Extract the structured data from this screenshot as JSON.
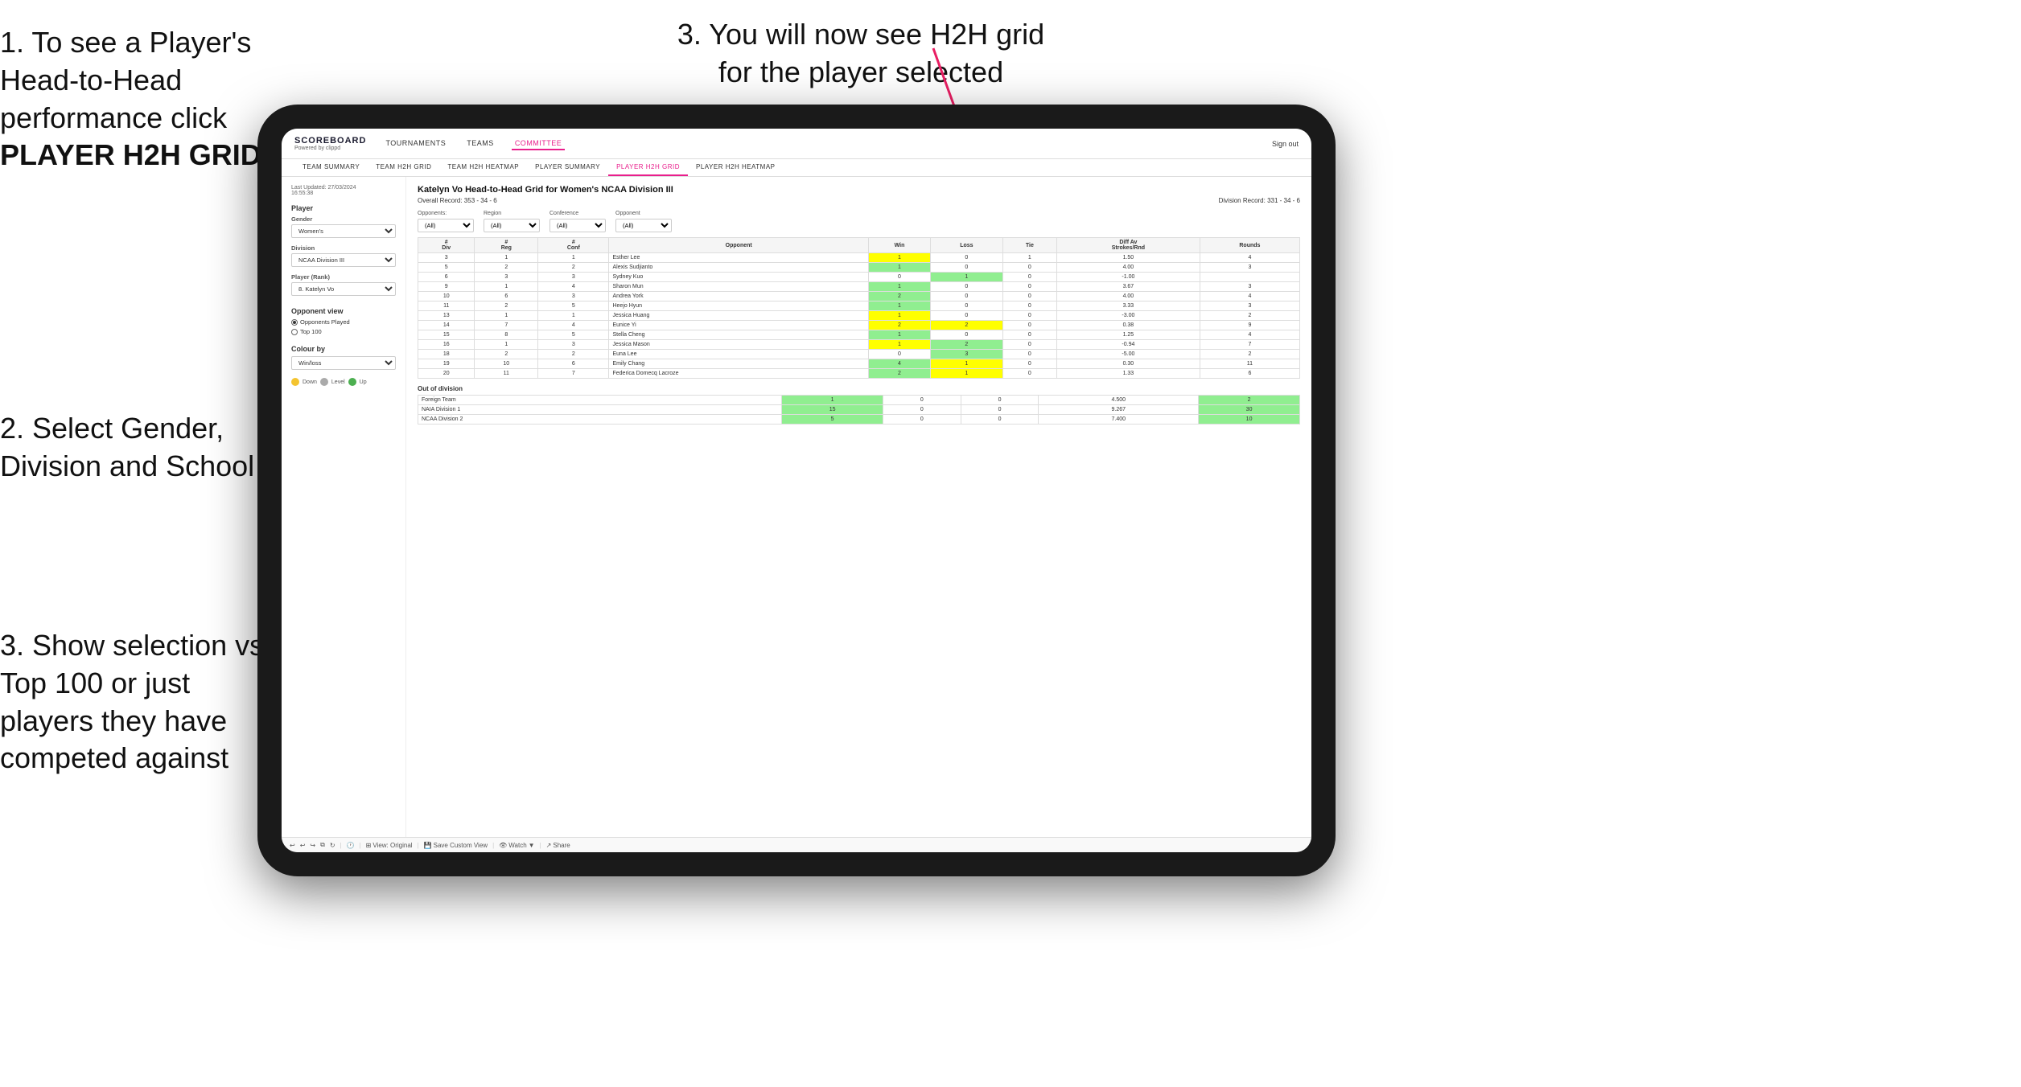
{
  "instructions": {
    "step1_heading": "1. To see a Player's Head-to-Head performance click",
    "step1_bold": "PLAYER H2H GRID",
    "step3_top": "3. You will now see H2H grid for the player selected",
    "step2": "2. Select Gender, Division and School",
    "step3_bottom": "3. Show selection vs Top 100 or just players they have competed against"
  },
  "nav": {
    "logo": "SCOREBOARD",
    "logo_sub": "Powered by clippd",
    "items": [
      "TOURNAMENTS",
      "TEAMS",
      "COMMITTEE"
    ],
    "active_item": "COMMITTEE",
    "sign_out": "Sign out"
  },
  "sub_nav": {
    "items": [
      "TEAM SUMMARY",
      "TEAM H2H GRID",
      "TEAM H2H HEATMAP",
      "PLAYER SUMMARY",
      "PLAYER H2H GRID",
      "PLAYER H2H HEATMAP"
    ],
    "active": "PLAYER H2H GRID"
  },
  "left_panel": {
    "last_updated": "Last Updated: 27/03/2024",
    "last_updated_time": "16:55:38",
    "player_section": "Player",
    "gender_label": "Gender",
    "gender_value": "Women's",
    "division_label": "Division",
    "division_value": "NCAA Division III",
    "player_rank_label": "Player (Rank)",
    "player_rank_value": "8. Katelyn Vo",
    "opponent_view_label": "Opponent view",
    "opponent_options": [
      "Opponents Played",
      "Top 100"
    ],
    "selected_opponent": "Opponents Played",
    "colour_by_label": "Colour by",
    "colour_by_value": "Win/loss",
    "legend": [
      {
        "color": "#f4c430",
        "label": "Down"
      },
      {
        "color": "#aaa",
        "label": "Level"
      },
      {
        "color": "#4caf50",
        "label": "Up"
      }
    ]
  },
  "main_grid": {
    "title": "Katelyn Vo Head-to-Head Grid for Women's NCAA Division III",
    "overall_record": "Overall Record: 353 - 34 - 6",
    "division_record": "Division Record: 331 - 34 - 6",
    "filters": {
      "opponents_label": "Opponents:",
      "opponents_value": "(All)",
      "region_label": "Region",
      "region_value": "(All)",
      "conference_label": "Conference",
      "conference_value": "(All)",
      "opponent_label": "Opponent",
      "opponent_value": "(All)"
    },
    "table_headers": [
      "#\nDiv",
      "#\nReg",
      "#\nConf",
      "Opponent",
      "Win",
      "Loss",
      "Tie",
      "Diff Av\nStrokes/Rnd",
      "Rounds"
    ],
    "rows": [
      {
        "div": 3,
        "reg": 1,
        "conf": 1,
        "opponent": "Esther Lee",
        "win": 1,
        "loss": 0,
        "tie": 1,
        "diff": "1.50",
        "rounds": 4,
        "win_color": "cell-yellow",
        "loss_color": "cell-white",
        "tie_color": "cell-white"
      },
      {
        "div": 5,
        "reg": 2,
        "conf": 2,
        "opponent": "Alexis Sudjianto",
        "win": 1,
        "loss": 0,
        "tie": 0,
        "diff": "4.00",
        "rounds": 3,
        "win_color": "cell-green",
        "loss_color": "cell-white",
        "tie_color": "cell-white"
      },
      {
        "div": 6,
        "reg": 3,
        "conf": 3,
        "opponent": "Sydney Kuo",
        "win": 0,
        "loss": 1,
        "tie": 0,
        "diff": "-1.00",
        "rounds": "",
        "win_color": "cell-white",
        "loss_color": "cell-green",
        "tie_color": "cell-white"
      },
      {
        "div": 9,
        "reg": 1,
        "conf": 4,
        "opponent": "Sharon Mun",
        "win": 1,
        "loss": 0,
        "tie": 0,
        "diff": "3.67",
        "rounds": 3,
        "win_color": "cell-green",
        "loss_color": "cell-white",
        "tie_color": "cell-white"
      },
      {
        "div": 10,
        "reg": 6,
        "conf": 3,
        "opponent": "Andrea York",
        "win": 2,
        "loss": 0,
        "tie": 0,
        "diff": "4.00",
        "rounds": 4,
        "win_color": "cell-green",
        "loss_color": "cell-white",
        "tie_color": "cell-white"
      },
      {
        "div": 11,
        "reg": 2,
        "conf": 5,
        "opponent": "Heejo Hyun",
        "win": 1,
        "loss": 0,
        "tie": 0,
        "diff": "3.33",
        "rounds": 3,
        "win_color": "cell-green",
        "loss_color": "cell-white",
        "tie_color": "cell-white"
      },
      {
        "div": 13,
        "reg": 1,
        "conf": 1,
        "opponent": "Jessica Huang",
        "win": 1,
        "loss": 0,
        "tie": 0,
        "diff": "-3.00",
        "rounds": 2,
        "win_color": "cell-yellow",
        "loss_color": "cell-white",
        "tie_color": "cell-white"
      },
      {
        "div": 14,
        "reg": 7,
        "conf": 4,
        "opponent": "Eunice Yi",
        "win": 2,
        "loss": 2,
        "tie": 0,
        "diff": "0.38",
        "rounds": 9,
        "win_color": "cell-yellow",
        "loss_color": "cell-yellow",
        "tie_color": "cell-white"
      },
      {
        "div": 15,
        "reg": 8,
        "conf": 5,
        "opponent": "Stella Cheng",
        "win": 1,
        "loss": 0,
        "tie": 0,
        "diff": "1.25",
        "rounds": 4,
        "win_color": "cell-green",
        "loss_color": "cell-white",
        "tie_color": "cell-white"
      },
      {
        "div": 16,
        "reg": 1,
        "conf": 3,
        "opponent": "Jessica Mason",
        "win": 1,
        "loss": 2,
        "tie": 0,
        "diff": "-0.94",
        "rounds": 7,
        "win_color": "cell-yellow",
        "loss_color": "cell-green",
        "tie_color": "cell-white"
      },
      {
        "div": 18,
        "reg": 2,
        "conf": 2,
        "opponent": "Euna Lee",
        "win": 0,
        "loss": 3,
        "tie": 0,
        "diff": "-5.00",
        "rounds": 2,
        "win_color": "cell-white",
        "loss_color": "cell-green",
        "tie_color": "cell-white"
      },
      {
        "div": 19,
        "reg": 10,
        "conf": 6,
        "opponent": "Emily Chang",
        "win": 4,
        "loss": 1,
        "tie": 0,
        "diff": "0.30",
        "rounds": 11,
        "win_color": "cell-green",
        "loss_color": "cell-yellow",
        "tie_color": "cell-white"
      },
      {
        "div": 20,
        "reg": 11,
        "conf": 7,
        "opponent": "Federica Domecq Lacroze",
        "win": 2,
        "loss": 1,
        "tie": 0,
        "diff": "1.33",
        "rounds": 6,
        "win_color": "cell-green",
        "loss_color": "cell-yellow",
        "tie_color": "cell-white"
      }
    ],
    "out_of_division_label": "Out of division",
    "out_of_division_rows": [
      {
        "opponent": "Foreign Team",
        "win": 1,
        "loss": 0,
        "tie": 0,
        "diff": "4.500",
        "rounds": 2,
        "win_color": "cell-green"
      },
      {
        "opponent": "NAIA Division 1",
        "win": 15,
        "loss": 0,
        "tie": 0,
        "diff": "9.267",
        "rounds": 30,
        "win_color": "cell-green"
      },
      {
        "opponent": "NCAA Division 2",
        "win": 5,
        "loss": 0,
        "tie": 0,
        "diff": "7.400",
        "rounds": 10,
        "win_color": "cell-green"
      }
    ]
  },
  "toolbar": {
    "view_original": "View: Original",
    "save_custom": "Save Custom View",
    "watch": "Watch",
    "share": "Share"
  }
}
